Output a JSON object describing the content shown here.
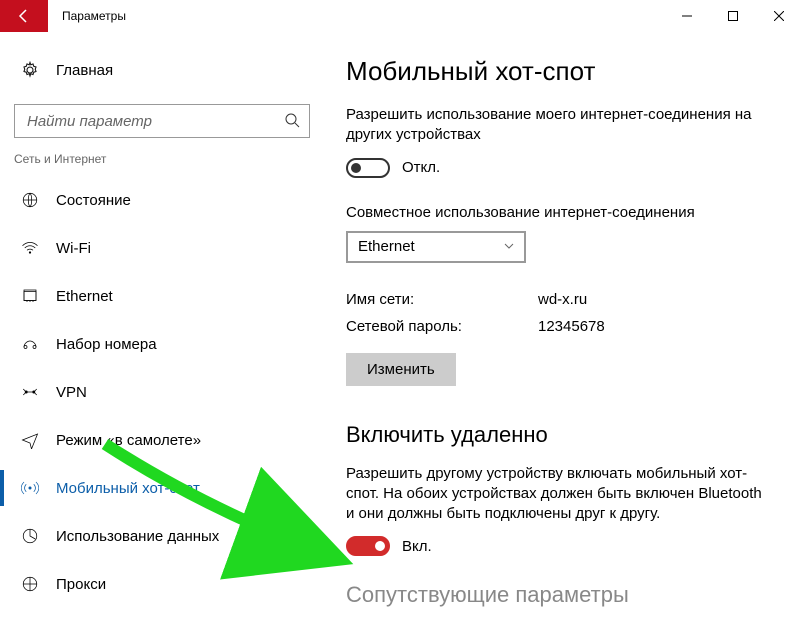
{
  "window": {
    "title": "Параметры"
  },
  "sidebar": {
    "home": "Главная",
    "search_placeholder": "Найти параметр",
    "category": "Сеть и Интернет",
    "items": [
      {
        "label": "Состояние"
      },
      {
        "label": "Wi-Fi"
      },
      {
        "label": "Ethernet"
      },
      {
        "label": "Набор номера"
      },
      {
        "label": "VPN"
      },
      {
        "label": "Режим «в самолете»"
      },
      {
        "label": "Мобильный хот-спот"
      },
      {
        "label": "Использование данных"
      },
      {
        "label": "Прокси"
      }
    ]
  },
  "main": {
    "title": "Мобильный хот-спот",
    "share_desc": "Разрешить использование моего интернет-соединения на других устройствах",
    "toggle_off": "Откл.",
    "share_from_label": "Совместное использование интернет-соединения",
    "share_from_value": "Ethernet",
    "net_name_label": "Имя сети:",
    "net_name_value": "wd-x.ru",
    "net_pass_label": "Сетевой пароль:",
    "net_pass_value": "12345678",
    "edit_btn": "Изменить",
    "remote_title": "Включить удаленно",
    "remote_desc": "Разрешить другому устройству включать мобильный хот-спот. На обоих устройствах должен быть включен Bluetooth и они должны быть подключены друг к другу.",
    "toggle_on": "Вкл.",
    "related_title": "Сопутствующие параметры"
  }
}
